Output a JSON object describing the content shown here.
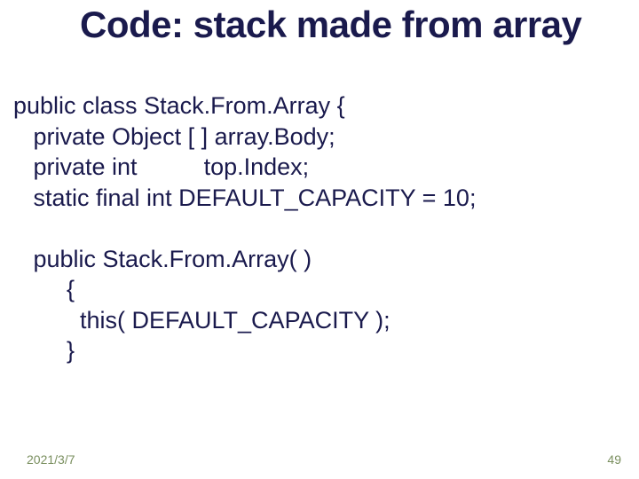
{
  "title": "Code: stack made from array",
  "code": {
    "l1": "public class Stack.From.Array {",
    "l2": "   private Object [ ] array.Body;",
    "l3": "   private int          top.Index;",
    "l4": "   static final int DEFAULT_CAPACITY = 10;",
    "l5": "",
    "l6": "   public Stack.From.Array( )",
    "l7": "        {",
    "l8": "          this( DEFAULT_CAPACITY );",
    "l9": "        }"
  },
  "footer": {
    "date": "2021/3/7",
    "page": "49"
  }
}
